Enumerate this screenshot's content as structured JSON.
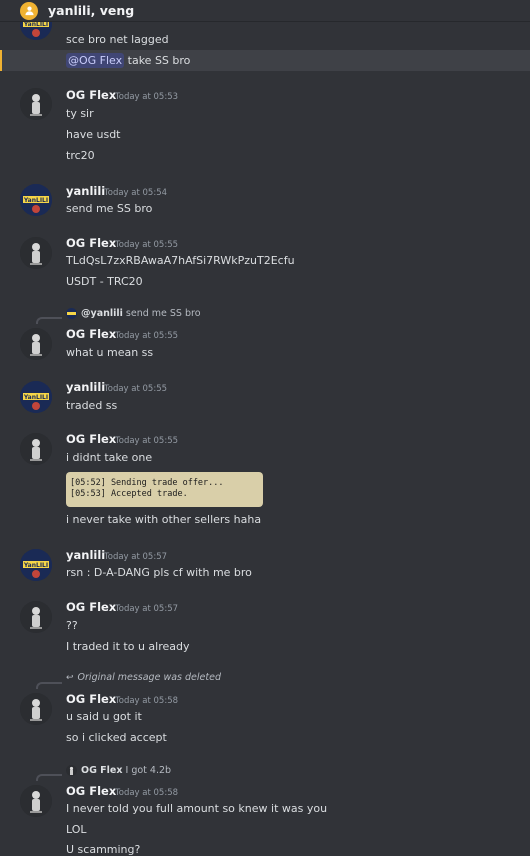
{
  "header": {
    "title": "yanlili, veng",
    "icon": "group-dm-icon"
  },
  "colors": {
    "background": "#313338",
    "mention": "#404675",
    "highlight_bar": "#f0b232"
  },
  "messages": [
    {
      "lines": [
        "sce bro   net lagged"
      ]
    },
    {
      "mention": "@OG Flex",
      "after": " take SS bro"
    },
    {
      "author": "OG Flex",
      "time": "Today at 05:53",
      "lines": [
        "ty sir",
        "have usdt",
        "trc20"
      ]
    },
    {
      "author": "yanlili",
      "time": "Today at 05:54",
      "lines": [
        "send me SS bro"
      ]
    },
    {
      "author": "OG Flex",
      "time": "Today at 05:55",
      "lines": [
        "TLdQsL7zxRBAwaA7hAfSi7RWkPzuT2Ecfu",
        "USDT - TRC20"
      ]
    },
    {
      "reply_to": "@yanlili",
      "reply_text": "send me SS bro",
      "author": "OG Flex",
      "time": "Today at 05:55",
      "lines": [
        "what u mean ss"
      ]
    },
    {
      "author": "yanlili",
      "time": "Today at 05:55",
      "lines": [
        "traded ss"
      ]
    },
    {
      "author": "OG Flex",
      "time": "Today at 05:55",
      "lines": [
        "i didnt take one"
      ],
      "attachment": [
        "[05:52] Sending trade offer...",
        "[05:53] Accepted trade."
      ],
      "after_attachment": "i never take with other sellers haha"
    },
    {
      "author": "yanlili",
      "time": "Today at 05:57",
      "lines": [
        "rsn : D-A-DANG        pls   cf with me bro"
      ]
    },
    {
      "author": "OG Flex",
      "time": "Today at 05:57",
      "lines": [
        "??",
        "I traded it to u already"
      ]
    },
    {
      "reply_text": "Original message was deleted",
      "author": "OG Flex",
      "time": "Today at 05:58",
      "lines": [
        "u said u got it",
        "so i clicked accept"
      ]
    },
    {
      "reply_to": "OG Flex",
      "reply_text": "I got 4.2b",
      "author": "OG Flex",
      "time": "Today at 05:58",
      "lines": [
        "I never told you full amount so knew it was you",
        "LOL",
        "U scamming?"
      ]
    }
  ]
}
